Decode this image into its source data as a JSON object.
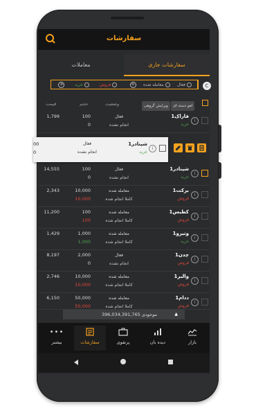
{
  "header": {
    "title": "سفارشات"
  },
  "tabs": [
    {
      "label": "سفارشات جاری",
      "active": true
    },
    {
      "label": "معاملات",
      "active": false
    }
  ],
  "filters": {
    "status": {
      "active": "فعال",
      "done": "معامله شده",
      "clear": "⊗"
    },
    "side": {
      "buy": "خرید",
      "sell": "فروش",
      "clear": "⊗"
    }
  },
  "columns": {
    "cancel_group": "لغو دسته ای",
    "edit_group": "ویرایش گروهی",
    "status": "وضعیت",
    "volume": "حجم",
    "price": "قیمت"
  },
  "orders": [
    {
      "symbol": "فاراک1",
      "side": "خرید",
      "side_type": "buy",
      "status": "فعال",
      "status_detail": "انجام نشده",
      "volume": "100",
      "filled": "0",
      "filled_color": "normal",
      "price": "1,799"
    },
    {
      "symbol": "شپنادر1",
      "side": "خرید",
      "side_type": "buy",
      "status": "فعال",
      "status_detail": "انجام نشده",
      "volume": "100",
      "filled": "0",
      "filled_color": "normal",
      "price": "14,555"
    },
    {
      "symbol": "برکت1",
      "side": "فروش",
      "side_type": "sell",
      "status": "معامله شده",
      "status_detail": "کاملا انجام شده",
      "volume": "10,000",
      "filled": "10,000",
      "filled_color": "red",
      "price": "2,343"
    },
    {
      "symbol": "کطبس1",
      "side": "فروش",
      "side_type": "sell",
      "status": "معامله شده",
      "status_detail": "کاملا انجام شده",
      "volume": "100",
      "filled": "100",
      "filled_color": "red",
      "price": "11,200"
    },
    {
      "symbol": "وتیرو1",
      "side": "خرید",
      "side_type": "buy",
      "status": "معامله شده",
      "status_detail": "کاملا انجام شده",
      "volume": "1,000",
      "filled": "1,000",
      "filled_color": "green",
      "price": "1,429"
    },
    {
      "symbol": "چدن1",
      "side": "فروش",
      "side_type": "sell",
      "status": "فعال",
      "status_detail": "انجام نشده",
      "volume": "2,000",
      "filled": "0",
      "filled_color": "normal",
      "price": "8,197"
    },
    {
      "symbol": "والبر1",
      "side": "فروش",
      "side_type": "sell",
      "status": "معامله شده",
      "status_detail": "کاملا انجام شده",
      "volume": "10,000",
      "filled": "10,000",
      "filled_color": "red",
      "price": "2,746"
    },
    {
      "symbol": "ددام1",
      "side": "فروش",
      "side_type": "sell",
      "status": "معامله شده",
      "status_detail": "کاملا انجام شده",
      "volume": "50,000",
      "filled": "50,000",
      "filled_color": "red",
      "price": "6,150"
    }
  ],
  "swiped_row": {
    "symbol": "شپنادر1",
    "side": "خرید",
    "status": "فعال",
    "status_detail": "انجام نشده",
    "volume": "00",
    "filled": "0"
  },
  "balance": {
    "label": "موجودی",
    "value": "396,034,391,765"
  },
  "bottom_nav": [
    {
      "label": "بازار",
      "icon": "market-icon"
    },
    {
      "label": "دیده بان",
      "icon": "watchlist-chart-icon"
    },
    {
      "label": "پرتفوی",
      "icon": "portfolio-briefcase-icon"
    },
    {
      "label": "سفارشات",
      "icon": "orders-list-icon",
      "active": true
    },
    {
      "label": "بیشتر",
      "icon": "more-dots-icon"
    }
  ],
  "colors": {
    "accent": "#f5a21e",
    "sell": "#e0483d",
    "buy": "#4ea44e"
  }
}
